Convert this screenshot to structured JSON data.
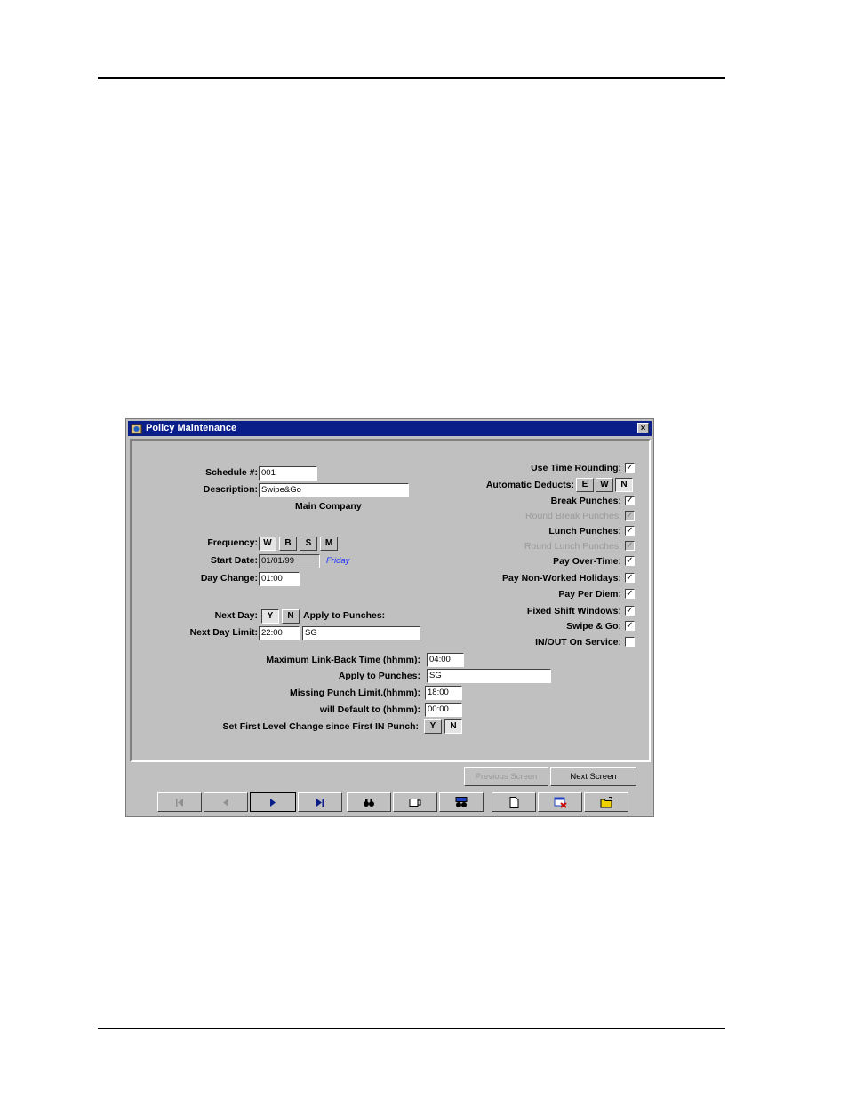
{
  "window": {
    "title": "Policy Maintenance",
    "close_glyph": "×"
  },
  "left": {
    "schedule_label": "Schedule #:",
    "schedule_value": "001",
    "description_label": "Description:",
    "description_value": "Swipe&Go",
    "company": "Main Company",
    "frequency_label": "Frequency:",
    "frequency_options": [
      "W",
      "B",
      "S",
      "M"
    ],
    "frequency_selected": "W",
    "start_date_label": "Start Date:",
    "start_date_value": "01/01/99",
    "start_day": "Friday",
    "day_change_label": "Day Change:",
    "day_change_value": "01:00",
    "next_day_label": "Next Day:",
    "next_day_options": [
      "Y",
      "N"
    ],
    "next_day_selected": "Y",
    "apply_to_punches_label": "Apply to Punches:",
    "next_day_limit_label": "Next Day Limit:",
    "next_day_limit_value": "22:00",
    "next_day_apply_value": "SG"
  },
  "center": {
    "max_link_back_label": "Maximum Link-Back Time (hhmm):",
    "max_link_back_value": "04:00",
    "apply_to_punches_label": "Apply to Punches:",
    "apply_to_punches_value": "SG",
    "missing_punch_label": "Missing Punch Limit.(hhmm):",
    "missing_punch_value": "18:00",
    "default_to_label": "will Default to (hhmm):",
    "default_to_value": "00:00",
    "first_level_label": "Set First Level Change since First IN Punch:",
    "first_level_options": [
      "Y",
      "N"
    ],
    "first_level_selected": "N"
  },
  "right": {
    "use_time_rounding": {
      "label": "Use Time Rounding:",
      "checked": true
    },
    "automatic_deducts": {
      "label": "Automatic Deducts:",
      "options": [
        "E",
        "W",
        "N"
      ],
      "selected": "N"
    },
    "break_punches": {
      "label": "Break Punches:",
      "checked": true
    },
    "round_break_punches": {
      "label": "Round Break Punches:",
      "checked": true,
      "disabled": true
    },
    "lunch_punches": {
      "label": "Lunch Punches:",
      "checked": true
    },
    "round_lunch_punches": {
      "label": "Round Lunch Punches:",
      "checked": true,
      "disabled": true
    },
    "pay_over_time": {
      "label": "Pay Over-Time:",
      "checked": true
    },
    "pay_non_worked_holidays": {
      "label": "Pay Non-Worked Holidays:",
      "checked": true
    },
    "pay_per_diem": {
      "label": "Pay Per Diem:",
      "checked": true
    },
    "fixed_shift_windows": {
      "label": "Fixed Shift Windows:",
      "checked": true
    },
    "swipe_go": {
      "label": "Swipe & Go:",
      "checked": true
    },
    "in_out_on_service": {
      "label": "IN/OUT On Service:",
      "checked": false
    }
  },
  "buttons": {
    "previous_screen": "Previous Screen",
    "next_screen": "Next Screen"
  },
  "toolbar": [
    "first-record-icon",
    "previous-record-icon",
    "next-record-icon",
    "last-record-icon",
    "binoculars-icon",
    "view-icon",
    "find-icon",
    "new-document-icon",
    "delete-icon",
    "open-folder-icon"
  ]
}
